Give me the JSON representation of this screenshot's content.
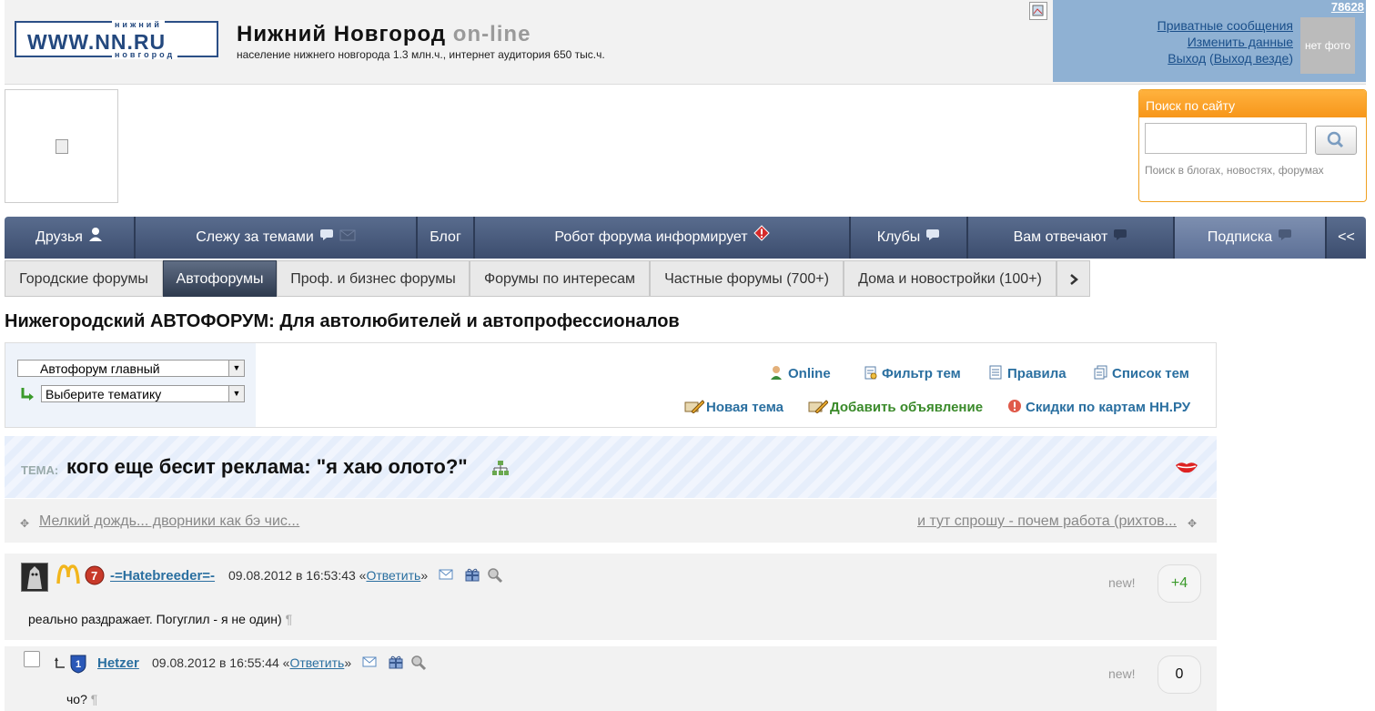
{
  "header": {
    "logo_text": "WWW.NN.RU",
    "logo_top": "нижний",
    "logo_bottom": "новгород",
    "title": "Нижний Новгород",
    "title_online": "on-line",
    "subtitle": "население нижнего новгорода 1.3 млн.ч., интернет аудитория 650 тыс.ч."
  },
  "user": {
    "count": "78628",
    "links": [
      "Приватные сообщения",
      "Изменить данные",
      "Выход"
    ],
    "exit_all": "Выход везде",
    "nophoto": "нет фото"
  },
  "search": {
    "title": "Поиск по сайту",
    "value": "",
    "hint": "Поиск в блогах, новостях, форумах"
  },
  "nav": {
    "items": [
      "Друзья",
      "Слежу за темами",
      "Блог",
      "Робот форума информирует",
      "Клубы",
      "Вам отвечают",
      "Подписка",
      "<<"
    ]
  },
  "tabs": {
    "items": [
      "Городские форумы",
      "Автофорумы",
      "Проф. и бизнес форумы",
      "Форумы по интересам",
      "Частные форумы (700+)",
      "Дома и новостройки (100+)"
    ]
  },
  "forum": {
    "title": "Нижегородский АВТОФОРУМ: Для автолюбителей и автопрофессионалов",
    "select_forum": "Автофорум главный",
    "select_topic": "Выберите тематику",
    "links": {
      "online": "Online",
      "filter": "Фильтр тем",
      "rules": "Правила",
      "list": "Список тем",
      "new_topic": "Новая тема",
      "add_ad": "Добавить объявление",
      "discounts": "Скидки по картам НН.РУ"
    }
  },
  "topic": {
    "label": "ТЕМА:",
    "title": "кого еще бесит реклама: \"я хаю олото?\"",
    "prev": "Мелкий дождь... дворники как бэ чис...",
    "next": "и тут спрошу - почем работа (рихтов..."
  },
  "posts": [
    {
      "author": "-=Hatebreeder=-",
      "date": "09.08.2012 в 16:53:43 «",
      "reply": "Ответить",
      "reply_end": "»",
      "new_label": "new!",
      "score": "+4",
      "text": "реально раздражает. Погуглил - я не один)",
      "para": "¶"
    },
    {
      "author": "Hetzer",
      "date": "09.08.2012 в 16:55:44 «",
      "reply": "Ответить",
      "reply_end": "»",
      "new_label": "new!",
      "score": "0",
      "text": "чо?",
      "para": "¶"
    }
  ],
  "colors": {
    "nav_dark": "#3c4d6e",
    "accent_orange": "#f7961a",
    "link": "#2a6fa0",
    "score_positive": "#3a9a2a"
  }
}
